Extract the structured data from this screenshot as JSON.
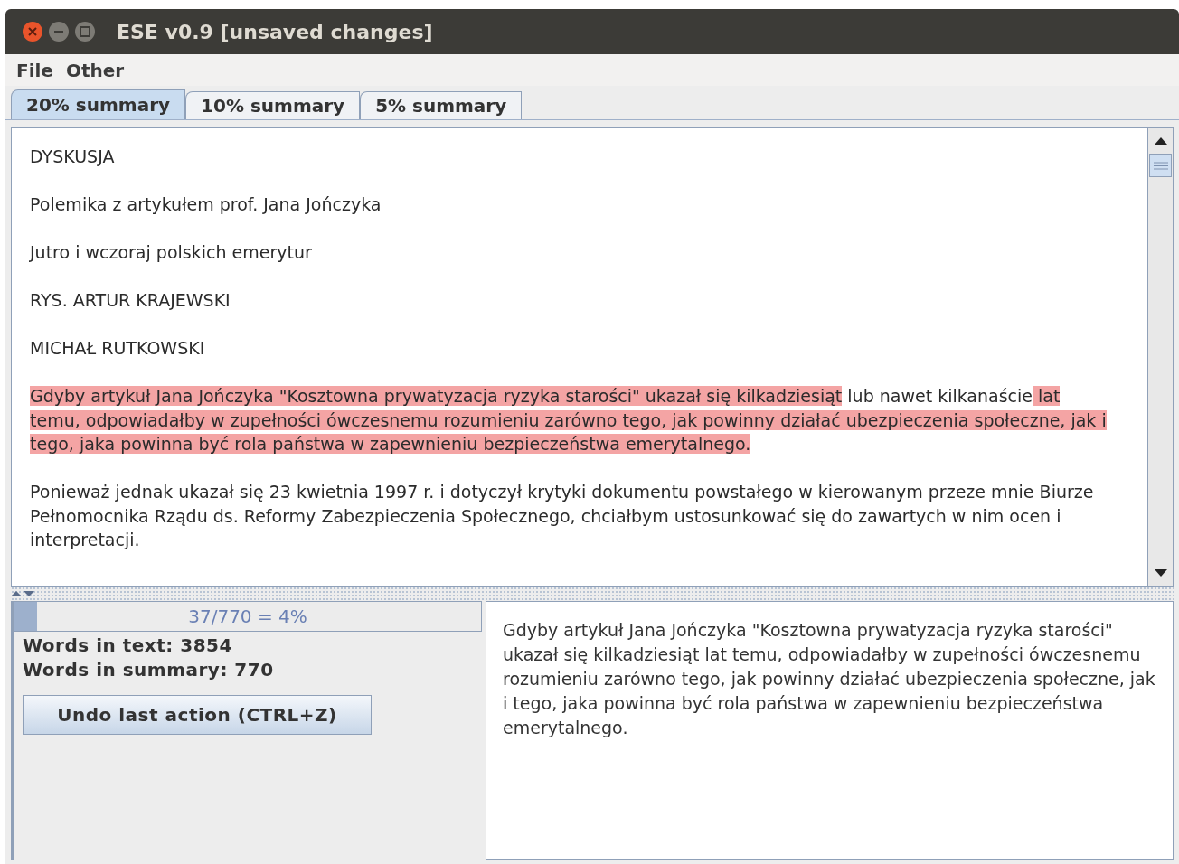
{
  "window": {
    "title": "ESE v0.9 [unsaved changes]"
  },
  "menu": [
    "File",
    "Other"
  ],
  "tabs": [
    {
      "label": "20% summary",
      "selected": true
    },
    {
      "label": "10% summary",
      "selected": false
    },
    {
      "label": "5% summary",
      "selected": false
    }
  ],
  "document": {
    "paragraphs": [
      {
        "segments": [
          {
            "text": "DYSKUSJA",
            "highlighted": false
          }
        ]
      },
      {
        "segments": [
          {
            "text": "Polemika z artykułem prof. Jana Jończyka",
            "highlighted": false
          }
        ]
      },
      {
        "segments": [
          {
            "text": "Jutro i wczoraj polskich emerytur",
            "highlighted": false
          }
        ]
      },
      {
        "segments": [
          {
            "text": "RYS. ARTUR KRAJEWSKI",
            "highlighted": false
          }
        ]
      },
      {
        "segments": [
          {
            "text": "MICHAŁ RUTKOWSKI",
            "highlighted": false
          }
        ]
      },
      {
        "segments": [
          {
            "text": "Gdyby artykuł Jana Jończyka \"Kosztowna prywatyzacja ryzyka starości\" ukazał się kilkadziesiąt",
            "highlighted": true
          },
          {
            "text": " lub nawet kilkanaście",
            "highlighted": false
          },
          {
            "text": " lat temu, odpowiadałby w zupełności ówczesnemu rozumieniu zarówno tego, jak powinny działać ubezpieczenia społeczne, jak i tego, jaka powinna być rola państwa w zapewnieniu bezpieczeństwa emerytalnego. ",
            "highlighted": true
          }
        ]
      },
      {
        "segments": [
          {
            "text": "Ponieważ jednak ukazał się 23 kwietnia 1997 r. i dotyczył krytyki dokumentu powstałego w kierowanym przeze mnie Biurze Pełnomocnika Rządu ds. Reformy Zabezpieczenia Społecznego, chciałbym ustosunkować się do zawartych w nim ocen i interpretacji.",
            "highlighted": false
          }
        ]
      }
    ]
  },
  "progress": {
    "text": "37/770 = 4%",
    "level": 0.048
  },
  "stats": [
    "Words in text: 3854",
    "Words in summary: 770"
  ],
  "undo_button": "Undo last action (CTRL+Z)",
  "summary_text": "Gdyby artykuł Jana Jończyka \"Kosztowna prywatyzacja ryzyka starości\" ukazał się kilkadziesiąt lat temu, odpowiadałby w zupełności ówczesnemu rozumieniu zarówno tego, jak powinny działać ubezpieczenia społeczne, jak i tego, jaka powinna być rola państwa w zapewnieniu bezpieczeństwa emerytalnego."
}
